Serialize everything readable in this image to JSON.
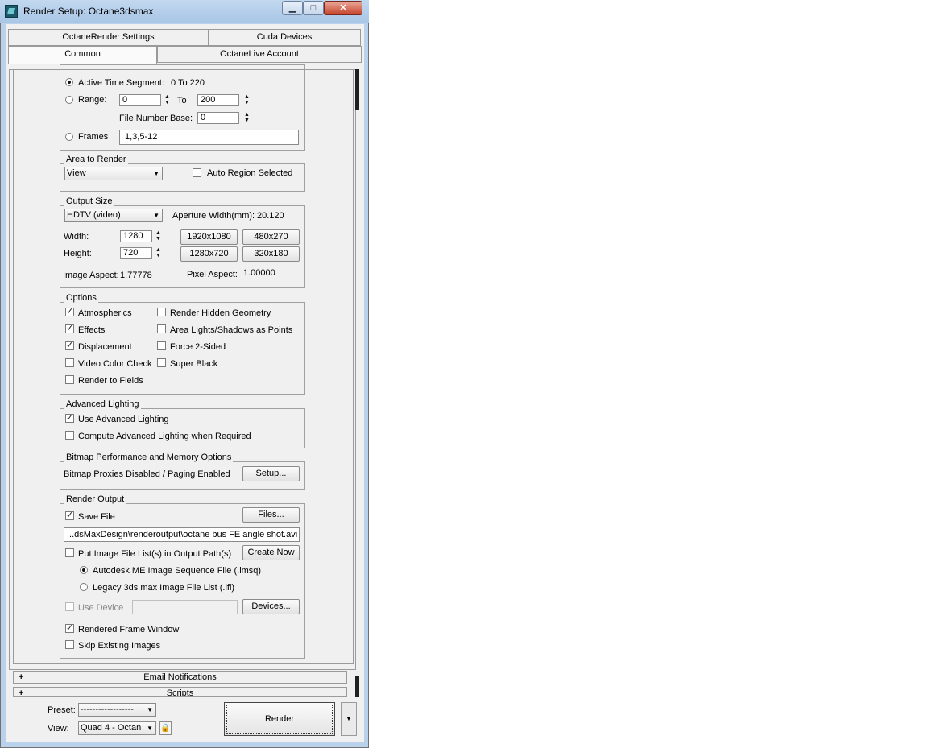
{
  "window": {
    "title": "Render Setup: Octane3dsmax",
    "min": "▁",
    "max": "□",
    "close": "✕"
  },
  "tabs": {
    "row1": [
      "OctaneRender Settings",
      "Cuda Devices"
    ],
    "row2": [
      "Common",
      "OctaneLive Account"
    ]
  },
  "timeout": {
    "active_time_label": "Active Time Segment:",
    "active_time_value": "0 To 220",
    "range_label": "Range:",
    "range_from": "0",
    "to_label": "To",
    "range_to": "200",
    "file_number_base_label": "File Number Base:",
    "file_number_base": "0",
    "frames_label": "Frames",
    "frames_value": "1,3,5-12"
  },
  "area_to_render": {
    "label": "Area to Render",
    "selected": "View",
    "auto_region_label": "Auto Region Selected",
    "auto_region_checked": false
  },
  "output_size": {
    "label": "Output Size",
    "preset": "HDTV (video)",
    "aperture_label": "Aperture Width(mm):",
    "aperture_value": "20.120",
    "width_label": "Width:",
    "width": "1280",
    "height_label": "Height:",
    "height": "720",
    "presets": [
      "1920x1080",
      "480x270",
      "1280x720",
      "320x180"
    ],
    "image_aspect_label": "Image Aspect:",
    "image_aspect": "1.77778",
    "pixel_aspect_label": "Pixel Aspect:",
    "pixel_aspect": "1.00000"
  },
  "options": {
    "label": "Options",
    "left": [
      {
        "label": "Atmospherics",
        "checked": true
      },
      {
        "label": "Effects",
        "checked": true
      },
      {
        "label": "Displacement",
        "checked": true
      },
      {
        "label": "Video Color Check",
        "checked": false
      },
      {
        "label": "Render to Fields",
        "checked": false
      }
    ],
    "right": [
      {
        "label": "Render Hidden Geometry",
        "checked": false
      },
      {
        "label": "Area Lights/Shadows as Points",
        "checked": false
      },
      {
        "label": "Force 2-Sided",
        "checked": false
      },
      {
        "label": "Super Black",
        "checked": false
      }
    ]
  },
  "advanced_lighting": {
    "label": "Advanced Lighting",
    "use_label": "Use Advanced Lighting",
    "use_checked": true,
    "compute_label": "Compute Advanced Lighting when Required",
    "compute_checked": false
  },
  "bitmap": {
    "label": "Bitmap Performance and Memory Options",
    "status": "Bitmap Proxies Disabled / Paging Enabled",
    "setup_button": "Setup..."
  },
  "render_output": {
    "label": "Render Output",
    "save_file_label": "Save File",
    "save_file_checked": true,
    "files_button": "Files...",
    "path": "...dsMaxDesign\\renderoutput\\octane bus FE angle shot.avi",
    "put_image_label": "Put Image File List(s) in Output Path(s)",
    "put_image_checked": false,
    "create_now_button": "Create Now",
    "imsq_label": "Autodesk ME Image Sequence File (.imsq)",
    "ifl_label": "Legacy 3ds max Image File List (.ifl)",
    "use_device_label": "Use Device",
    "devices_button": "Devices...",
    "rendered_frame_label": "Rendered Frame Window",
    "rendered_frame_checked": true,
    "skip_existing_label": "Skip Existing Images",
    "skip_existing_checked": false
  },
  "rollouts": [
    {
      "label": "Email Notifications",
      "toggle": "+"
    },
    {
      "label": "Scripts",
      "toggle": "+"
    }
  ],
  "footer": {
    "preset_label": "Preset:",
    "preset_value": "------------------",
    "view_label": "View:",
    "view_value": "Quad 4 - Octan",
    "render_button": "Render",
    "lock_glyph": "🔒",
    "dropdown_glyph": "▼"
  }
}
